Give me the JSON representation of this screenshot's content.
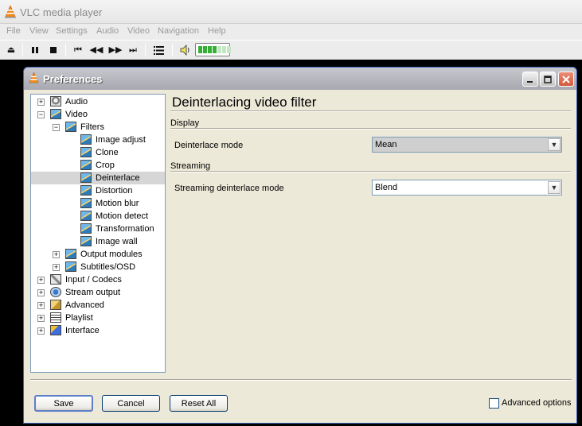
{
  "main_window": {
    "title": "VLC media player",
    "menu": [
      "File",
      "View",
      "Settings",
      "Audio",
      "Video",
      "Navigation",
      "Help"
    ]
  },
  "toolbar": {
    "eject_icon": "eject-icon",
    "pause_icon": "pause-icon",
    "stop_icon": "stop-icon",
    "prev_icon": "previous-icon",
    "slower_icon": "slower-icon",
    "faster_icon": "faster-icon",
    "next_icon": "next-icon",
    "playlist_icon": "playlist-icon",
    "volume_icon": "speaker-icon",
    "volume_level": 0.6
  },
  "dialog": {
    "title": "Preferences",
    "tree": [
      {
        "label": "Audio",
        "expander": "+",
        "icon": "audio"
      },
      {
        "label": "Video",
        "expander": "−",
        "icon": "filter"
      },
      {
        "label": "Filters",
        "expander": "−",
        "icon": "filter"
      },
      {
        "label": "Image adjust",
        "icon": "filter"
      },
      {
        "label": "Clone",
        "icon": "filter"
      },
      {
        "label": "Crop",
        "icon": "filter"
      },
      {
        "label": "Deinterlace",
        "icon": "filter",
        "selected": true
      },
      {
        "label": "Distortion",
        "icon": "filter"
      },
      {
        "label": "Motion blur",
        "icon": "filter"
      },
      {
        "label": "Motion detect",
        "icon": "filter"
      },
      {
        "label": "Transformation",
        "icon": "filter"
      },
      {
        "label": "Image wall",
        "icon": "filter"
      },
      {
        "label": "Output modules",
        "expander": "+",
        "icon": "filter"
      },
      {
        "label": "Subtitles/OSD",
        "expander": "+",
        "icon": "filter"
      },
      {
        "label": "Input / Codecs",
        "expander": "+",
        "icon": "input"
      },
      {
        "label": "Stream output",
        "expander": "+",
        "icon": "stream"
      },
      {
        "label": "Advanced",
        "expander": "+",
        "icon": "adv"
      },
      {
        "label": "Playlist",
        "expander": "+",
        "icon": "playlist"
      },
      {
        "label": "Interface",
        "expander": "+",
        "icon": "iface"
      }
    ],
    "panel": {
      "title": "Deinterlacing video filter",
      "display_section": "Display",
      "deinterlace_mode_label": "Deinterlace mode",
      "deinterlace_mode_value": "Mean",
      "streaming_section": "Streaming",
      "streaming_mode_label": "Streaming deinterlace mode",
      "streaming_mode_value": "Blend"
    },
    "buttons": {
      "save": "Save",
      "cancel": "Cancel",
      "reset": "Reset All"
    },
    "advanced_options_label": "Advanced options",
    "advanced_options_checked": false
  }
}
